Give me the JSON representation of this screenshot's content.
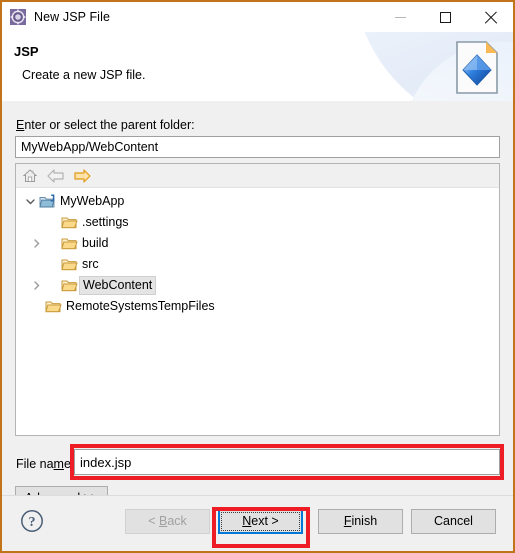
{
  "window": {
    "title": "New JSP File",
    "title_icon": "jsp-wizard-icon",
    "controls": {
      "minimize": "minimize-icon",
      "maximize": "maximize-icon",
      "close": "close-icon"
    },
    "border_color": "#c1741a"
  },
  "banner": {
    "title": "JSP",
    "subtitle": "Create a new JSP file.",
    "icon": "jsp-file-banner-icon"
  },
  "form": {
    "parent_folder_label": "Enter or select the parent folder:",
    "parent_folder_label_mnemonic": "E",
    "parent_folder_value": "MyWebApp/WebContent",
    "file_name_label": "File name:",
    "file_name_label_mnemonic": "m",
    "file_name_value": "index.jsp",
    "advanced_label": "Advanced >>",
    "advanced_mnemonic": "A"
  },
  "tree_toolbar": [
    {
      "name": "home-icon",
      "label": "Home",
      "enabled": true
    },
    {
      "name": "back-arrow-icon",
      "label": "Back",
      "enabled": false
    },
    {
      "name": "forward-arrow-icon",
      "label": "Forward",
      "enabled": true
    }
  ],
  "tree": {
    "nodes": [
      {
        "label": "MyWebApp",
        "icon": "java-project-folder-icon",
        "indent": 0,
        "twisty": "expanded",
        "selected": false
      },
      {
        "label": ".settings",
        "icon": "folder-icon",
        "indent": 1,
        "twisty": "none",
        "selected": false
      },
      {
        "label": "build",
        "icon": "folder-icon",
        "indent": 1,
        "twisty": "collapsed",
        "selected": false
      },
      {
        "label": "src",
        "icon": "folder-icon",
        "indent": 1,
        "twisty": "none",
        "selected": false
      },
      {
        "label": "WebContent",
        "icon": "folder-icon",
        "indent": 1,
        "twisty": "collapsed",
        "selected": true
      },
      {
        "label": "RemoteSystemsTempFiles",
        "icon": "folder-icon",
        "indent": 0,
        "twisty": "none",
        "selected": false
      }
    ]
  },
  "footer": {
    "help_icon": "help-question-icon",
    "back_label": "< Back",
    "back_mnemonic": "B",
    "back_enabled": false,
    "next_label": "Next >",
    "next_mnemonic": "N",
    "next_focused": true,
    "finish_label": "Finish",
    "finish_mnemonic": "F",
    "cancel_label": "Cancel"
  },
  "annotations": {
    "highlight_color": "#ee1c25",
    "boxes": [
      "file-name-field",
      "next-button"
    ]
  }
}
